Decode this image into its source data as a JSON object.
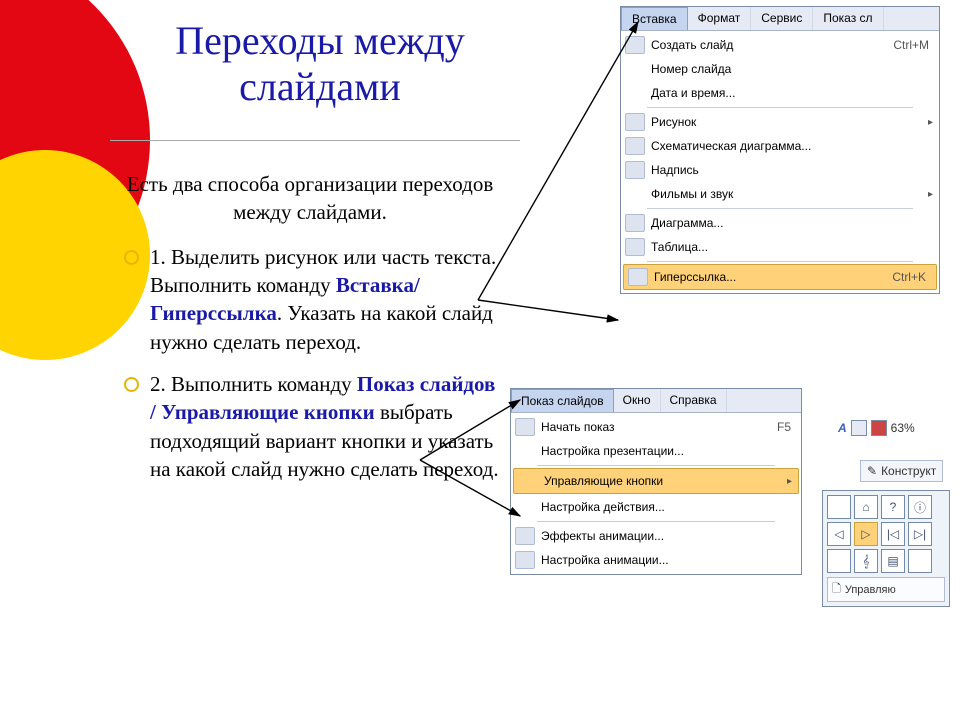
{
  "slide": {
    "title_line1": "Переходы между",
    "title_line2": "слайдами",
    "intro": "Есть два способа организации переходов между слайдами.",
    "item1_a": "1. Выделить рисунок или часть текста. Выполнить команду ",
    "item1_link": "Вставка/Гиперссылка",
    "item1_b": ". Указать на какой слайд нужно сделать переход.",
    "item2_a": "2. Выполнить команду ",
    "item2_link": "Показ слайдов / Управляющие кнопки",
    "item2_b": " выбрать подходящий вариант кнопки и указать на какой слайд нужно сделать переход."
  },
  "insert_menu": {
    "tabs": [
      "Вставка",
      "Формат",
      "Сервис",
      "Показ сл"
    ],
    "create": "Создать слайд",
    "create_hk": "Ctrl+M",
    "number": "Номер слайда",
    "datetime": "Дата и время...",
    "picture": "Рисунок",
    "diagram_sch": "Схематическая диаграмма...",
    "textbox": "Надпись",
    "movies": "Фильмы и звук",
    "chart": "Диаграмма...",
    "table": "Таблица...",
    "hyperlink": "Гиперссылка...",
    "hyperlink_hk": "Ctrl+K"
  },
  "show_menu": {
    "tabs": [
      "Показ слайдов",
      "Окно",
      "Справка"
    ],
    "start": "Начать показ",
    "start_hk": "F5",
    "setup": "Настройка презентации...",
    "action_btns": "Управляющие кнопки",
    "action_set": "Настройка действия...",
    "anim_fx": "Эффекты анимации...",
    "anim_set": "Настройка анимации..."
  },
  "fly": {
    "zoom": "63%",
    "konst": "Конструкт",
    "caption": "Управляю",
    "glyphs": [
      "",
      "⌂",
      "?",
      "ⓘ",
      "◁",
      "▷",
      "|◁",
      "▷|",
      "",
      "𝄞",
      "▤",
      ""
    ]
  }
}
